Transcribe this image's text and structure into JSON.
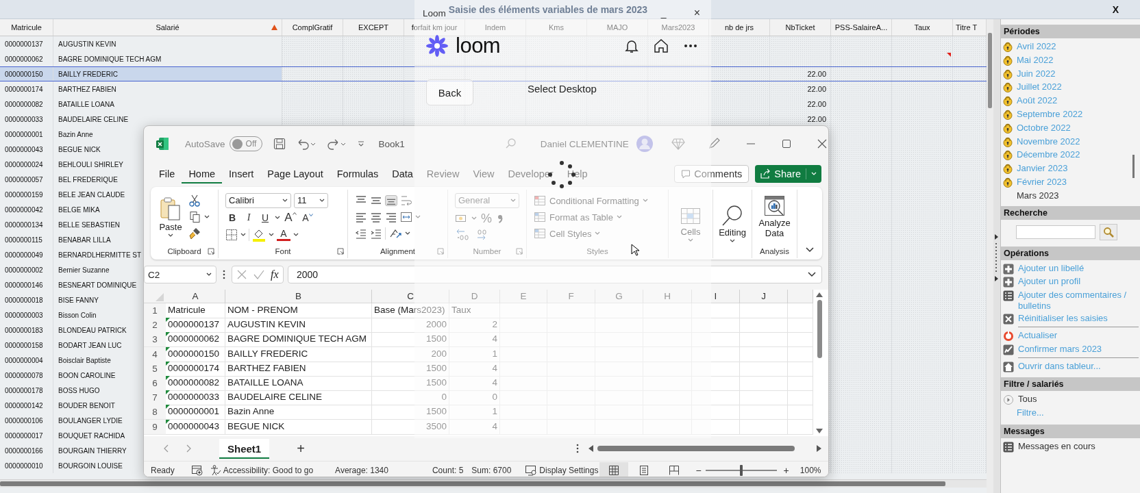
{
  "app": {
    "title": "Saisie des éléments variables de mars 2023",
    "close_label": "X"
  },
  "table": {
    "columns": [
      {
        "label": "Matricule",
        "sorted": false
      },
      {
        "label": "Salarié",
        "sorted": true
      },
      {
        "label": "ComplGratif",
        "sorted": false
      },
      {
        "label": "EXCEPT",
        "sorted": false
      },
      {
        "label": "forfait km jour",
        "sorted": false
      },
      {
        "label": "Indem",
        "sorted": false
      },
      {
        "label": "Kms",
        "sorted": false
      },
      {
        "label": "MAJO",
        "sorted": false
      },
      {
        "label": "Mars2023",
        "sorted": false
      },
      {
        "label": "nb de jrs",
        "sorted": false
      },
      {
        "label": "NbTicket",
        "sorted": false
      },
      {
        "label": "PSS-SalaireA...",
        "sorted": false
      },
      {
        "label": "Taux",
        "sorted": false
      },
      {
        "label": "Titre T",
        "sorted": false
      }
    ],
    "rows": [
      {
        "matricule": "0000000137",
        "name": "AUGUSTIN KEVIN",
        "selected": false,
        "flagged": false
      },
      {
        "matricule": "0000000062",
        "name": "BAGRE DOMINIQUE TECH AGM",
        "selected": false,
        "flagged": true
      },
      {
        "matricule": "0000000150",
        "name": "BAILLY FREDERIC",
        "nb_ticket": "22.00",
        "selected": true,
        "flagged": false
      },
      {
        "matricule": "0000000174",
        "name": "BARTHEZ FABIEN",
        "nb_ticket": "22.00",
        "selected": false,
        "flagged": false
      },
      {
        "matricule": "0000000082",
        "name": "BATAILLE LOANA",
        "nb_ticket": "22.00",
        "selected": false,
        "flagged": false
      },
      {
        "matricule": "0000000033",
        "name": "BAUDELAIRE CELINE",
        "nb_ticket": "22.00",
        "selected": false,
        "flagged": false
      },
      {
        "matricule": "0000000001",
        "name": "Bazin Anne",
        "selected": false,
        "flagged": false
      },
      {
        "matricule": "0000000043",
        "name": "BEGUE NICK",
        "selected": false,
        "flagged": false
      },
      {
        "matricule": "0000000024",
        "name": "BEHLOULI SHIRLEY",
        "selected": false,
        "flagged": false
      },
      {
        "matricule": "0000000057",
        "name": "BEL FREDERIQUE",
        "selected": false,
        "flagged": false
      },
      {
        "matricule": "0000000159",
        "name": "BELE JEAN CLAUDE",
        "selected": false,
        "flagged": false
      },
      {
        "matricule": "0000000042",
        "name": "BELGE MIKA",
        "selected": false,
        "flagged": false
      },
      {
        "matricule": "0000000134",
        "name": "BELLE SEBASTIEN",
        "selected": false,
        "flagged": false
      },
      {
        "matricule": "0000000115",
        "name": "BENABAR LILLA",
        "selected": false,
        "flagged": false
      },
      {
        "matricule": "0000000049",
        "name": "BERNARDLHERMITTE ST",
        "selected": false,
        "flagged": false
      },
      {
        "matricule": "0000000002",
        "name": "Bernier Suzanne",
        "selected": false,
        "flagged": false
      },
      {
        "matricule": "0000000146",
        "name": "BESNEART DOMINIQUE",
        "selected": false,
        "flagged": false
      },
      {
        "matricule": "0000000018",
        "name": "BISE FANNY",
        "selected": false,
        "flagged": false
      },
      {
        "matricule": "0000000003",
        "name": "Bisson Colin",
        "selected": false,
        "flagged": false
      },
      {
        "matricule": "0000000183",
        "name": "BLONDEAU PATRICK",
        "selected": false,
        "flagged": false
      },
      {
        "matricule": "0000000158",
        "name": "BODART JEAN LUC",
        "selected": false,
        "flagged": false
      },
      {
        "matricule": "0000000004",
        "name": "Boisclair Baptiste",
        "selected": false,
        "flagged": false
      },
      {
        "matricule": "0000000078",
        "name": "BOON CAROLINE",
        "selected": false,
        "flagged": false
      },
      {
        "matricule": "0000000178",
        "name": "BOSS HUGO",
        "selected": false,
        "flagged": false
      },
      {
        "matricule": "0000000142",
        "name": "BOUDER BENOIT",
        "selected": false,
        "flagged": false
      },
      {
        "matricule": "0000000106",
        "name": "BOULANGER LYDIE",
        "selected": false,
        "flagged": false
      },
      {
        "matricule": "0000000017",
        "name": "BOUQUET RACHIDA",
        "selected": false,
        "flagged": false
      },
      {
        "matricule": "0000000166",
        "name": "BOURGAIN THIERRY",
        "selected": false,
        "flagged": false
      },
      {
        "matricule": "0000000010",
        "name": "BOURGOIN LOUISE",
        "selected": false,
        "flagged": false
      }
    ]
  },
  "sidebar": {
    "sections": [
      {
        "title": "Périodes",
        "kind": "periods",
        "items": [
          {
            "label": "Avril 2022",
            "locked": true,
            "selected": false
          },
          {
            "label": "Mai 2022",
            "locked": true,
            "selected": false
          },
          {
            "label": "Juin 2022",
            "locked": true,
            "selected": false
          },
          {
            "label": "Juillet 2022",
            "locked": true,
            "selected": false
          },
          {
            "label": "Août 2022",
            "locked": true,
            "selected": false
          },
          {
            "label": "Septembre 2022",
            "locked": true,
            "selected": false
          },
          {
            "label": "Octobre 2022",
            "locked": true,
            "selected": false
          },
          {
            "label": "Novembre 2022",
            "locked": true,
            "selected": false
          },
          {
            "label": "Décembre 2022",
            "locked": true,
            "selected": false
          },
          {
            "label": "Janvier 2023",
            "locked": true,
            "selected": false
          },
          {
            "label": "Février 2023",
            "locked": true,
            "selected": false
          },
          {
            "label": "Mars 2023",
            "locked": false,
            "selected": true
          }
        ]
      },
      {
        "title": "Recherche",
        "kind": "search"
      },
      {
        "title": "Opérations",
        "kind": "actions",
        "groups": [
          [
            {
              "label": "Ajouter un libellé",
              "kind": "add",
              "link": true
            },
            {
              "label": "Ajouter un profil",
              "kind": "add",
              "link": true
            },
            {
              "label": "Ajouter des commentaires / bulletins",
              "kind": "list",
              "link": true
            },
            {
              "label": "Réinitialiser les saisies",
              "kind": "reset",
              "link": true
            }
          ],
          [
            {
              "label": "Actualiser",
              "kind": "refresh",
              "link": true
            },
            {
              "label": "Confirmer mars 2023",
              "kind": "confirm",
              "link": true
            }
          ],
          [
            {
              "label": "Ouvrir dans tableur...",
              "kind": "export",
              "link": true
            }
          ]
        ]
      },
      {
        "title": "Filtre / salariés",
        "kind": "actions",
        "groups": [
          [
            {
              "label": "Tous",
              "kind": "radio",
              "link": false
            },
            {
              "label": "Filtre...",
              "kind": "none",
              "link": true
            }
          ]
        ]
      },
      {
        "title": "Messages",
        "kind": "actions",
        "groups": [
          [
            {
              "label": "Messages en cours",
              "kind": "list",
              "link": false
            }
          ]
        ]
      }
    ]
  },
  "excel": {
    "autosave": {
      "label": "AutoSave",
      "toggle_text": "Off",
      "on": false
    },
    "file_name": "Book1",
    "user_name": "Daniel CLEMENTINE",
    "tabs": [
      {
        "label": "File",
        "selected": false
      },
      {
        "label": "Home",
        "selected": true
      },
      {
        "label": "Insert",
        "selected": false
      },
      {
        "label": "Page Layout",
        "selected": false
      },
      {
        "label": "Formulas",
        "selected": false
      },
      {
        "label": "Data",
        "selected": false
      },
      {
        "label": "Review",
        "selected": false
      },
      {
        "label": "View",
        "selected": false
      },
      {
        "label": "Developer",
        "selected": false
      },
      {
        "label": "Help",
        "selected": false
      }
    ],
    "comments_label": "Comments",
    "share_label": "Share",
    "ribbon": {
      "paste_label": "Paste",
      "font_name": "Calibri",
      "font_size": "11",
      "bold": "B",
      "italic": "I",
      "underline": "U",
      "grow_font": "A",
      "shrink_font": "A",
      "font_color": "A",
      "number_format": "General",
      "percent": "%",
      "styles": [
        "Conditional Formatting",
        "Format as Table",
        "Cell Styles"
      ],
      "cells_label": "Cells",
      "editing_label": "Editing",
      "analyze_label": "Analyze Data",
      "groups": [
        "Clipboard",
        "Font",
        "Alignment",
        "Number",
        "Styles",
        "Analysis"
      ]
    },
    "name_box": "C2",
    "fx": "fx",
    "formula": "2000",
    "columns": [
      "A",
      "B",
      "C",
      "D",
      "E",
      "F",
      "G",
      "H",
      "I",
      "J"
    ],
    "rows": [
      {
        "number": "1",
        "kind": "header",
        "text_number": false,
        "cells": [
          "Matricule",
          "NOM - PRENOM",
          "Base (Mars2023)",
          "Taux"
        ]
      },
      {
        "number": "2",
        "kind": "data",
        "text_number": true,
        "cells": [
          "0000000137",
          "AUGUSTIN KEVIN",
          "2000",
          "2"
        ]
      },
      {
        "number": "3",
        "kind": "data",
        "text_number": true,
        "cells": [
          "0000000062",
          "BAGRE DOMINIQUE TECH AGM",
          "1500",
          "4"
        ]
      },
      {
        "number": "4",
        "kind": "data",
        "text_number": true,
        "cells": [
          "0000000150",
          "BAILLY FREDERIC",
          "200",
          "1"
        ]
      },
      {
        "number": "5",
        "kind": "data",
        "text_number": true,
        "cells": [
          "0000000174",
          "BARTHEZ FABIEN",
          "1500",
          "4"
        ]
      },
      {
        "number": "6",
        "kind": "data",
        "text_number": true,
        "cells": [
          "0000000082",
          "BATAILLE LOANA",
          "1500",
          "4"
        ]
      },
      {
        "number": "7",
        "kind": "data",
        "text_number": true,
        "cells": [
          "0000000033",
          "BAUDELAIRE CELINE",
          "0",
          "0"
        ]
      },
      {
        "number": "8",
        "kind": "data",
        "text_number": true,
        "cells": [
          "0000000001",
          "Bazin Anne",
          "1500",
          "1"
        ]
      },
      {
        "number": "9",
        "kind": "data",
        "text_number": true,
        "cells": [
          "0000000043",
          "BEGUE NICK",
          "3500",
          "4"
        ]
      }
    ],
    "sheet_tabs": [
      {
        "label": "Sheet1",
        "selected": true
      }
    ],
    "add_sheet": "+",
    "status": {
      "ready": "Ready",
      "accessibility": "Accessibility: Good to go",
      "average": "Average: 1340",
      "count": "Count: 5",
      "sum": "Sum: 6700",
      "display_settings": "Display Settings",
      "views": [
        {
          "kind": "normal",
          "selected": true
        },
        {
          "kind": "page_layout",
          "selected": false
        },
        {
          "kind": "page_break",
          "selected": false
        }
      ],
      "zoom_out": "−",
      "zoom_in": "+",
      "zoom": {
        "level": 0.5
      },
      "zoom_text": "100%"
    }
  },
  "loom": {
    "title": "Loom",
    "minimize": "_",
    "close": "×",
    "brand": "loom",
    "back_label": "Back",
    "heading": "Select Desktop"
  }
}
